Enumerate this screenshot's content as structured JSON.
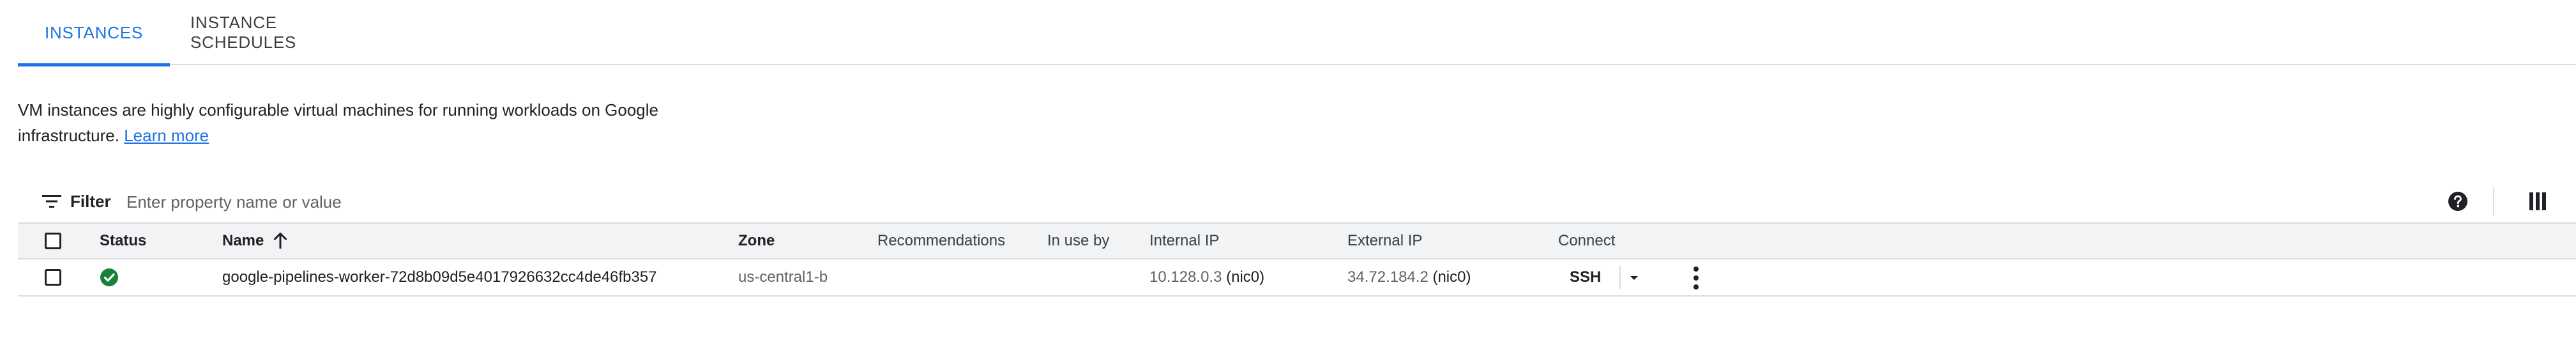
{
  "tabs": [
    {
      "label": "INSTANCES",
      "active": true
    },
    {
      "label": "INSTANCE SCHEDULES",
      "active": false
    }
  ],
  "description": {
    "text": "VM instances are highly configurable virtual machines for running workloads on Google infrastructure.",
    "link_label": "Learn more"
  },
  "filter": {
    "label": "Filter",
    "placeholder": "Enter property name or value",
    "icon": "filter-icon"
  },
  "toolbar": {
    "help_icon": "help-icon",
    "columns_icon": "column-display-icon"
  },
  "table": {
    "columns": {
      "status": "Status",
      "name": "Name",
      "zone": "Zone",
      "recommendations": "Recommendations",
      "in_use_by": "In use by",
      "internal_ip": "Internal IP",
      "external_ip": "External IP",
      "connect": "Connect"
    },
    "sort": {
      "column": "Name",
      "direction": "ascending"
    },
    "rows": [
      {
        "status": "running",
        "status_icon": "check-circle-icon",
        "status_color": "#188038",
        "name": "google-pipelines-worker-72d8b09d5e4017926632cc4de46fb357",
        "zone": "us-central1-b",
        "recommendations": "",
        "in_use_by": "",
        "internal_ip": "10.128.0.3",
        "internal_nic": "(nic0)",
        "external_ip": "34.72.184.2",
        "external_nic": "(nic0)",
        "connect_label": "SSH"
      }
    ]
  },
  "colors": {
    "accent": "#1a73e8",
    "text": "#202124",
    "muted": "#5f6368",
    "border": "#dadce0",
    "header_bg": "#f1f3f4",
    "status_ok": "#188038"
  }
}
